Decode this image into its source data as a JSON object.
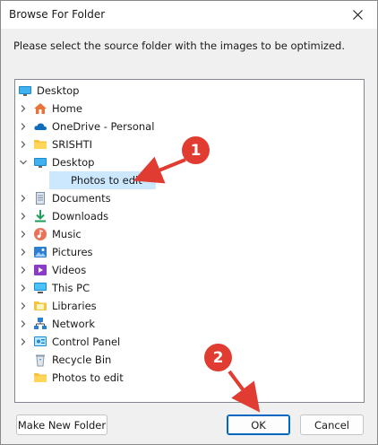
{
  "window": {
    "title": "Browse For Folder"
  },
  "instruction": "Please select the source folder with the images to be optimized.",
  "tree": [
    {
      "label": "Desktop",
      "icon": "desktop-icon",
      "level": 0,
      "chevron": "none"
    },
    {
      "label": "Home",
      "icon": "home-icon",
      "level": 1,
      "chevron": "right"
    },
    {
      "label": "OneDrive - Personal",
      "icon": "cloud-icon",
      "level": 1,
      "chevron": "right"
    },
    {
      "label": "SRISHTI",
      "icon": "folder-icon",
      "level": 1,
      "chevron": "right"
    },
    {
      "label": "Desktop",
      "icon": "desktop-icon",
      "level": 1,
      "chevron": "down"
    },
    {
      "label": "Photos to edit",
      "icon": "folder-icon",
      "level": 2,
      "chevron": "none",
      "selected": true
    },
    {
      "label": "Documents",
      "icon": "documents-icon",
      "level": 1,
      "chevron": "right"
    },
    {
      "label": "Downloads",
      "icon": "download-icon",
      "level": 1,
      "chevron": "right"
    },
    {
      "label": "Music",
      "icon": "music-icon",
      "level": 1,
      "chevron": "right"
    },
    {
      "label": "Pictures",
      "icon": "pictures-icon",
      "level": 1,
      "chevron": "right"
    },
    {
      "label": "Videos",
      "icon": "videos-icon",
      "level": 1,
      "chevron": "right"
    },
    {
      "label": "This PC",
      "icon": "pc-icon",
      "level": 1,
      "chevron": "right"
    },
    {
      "label": "Libraries",
      "icon": "libraries-icon",
      "level": 1,
      "chevron": "right"
    },
    {
      "label": "Network",
      "icon": "network-icon",
      "level": 1,
      "chevron": "right"
    },
    {
      "label": "Control Panel",
      "icon": "control-panel-icon",
      "level": 1,
      "chevron": "right"
    },
    {
      "label": "Recycle Bin",
      "icon": "recycle-bin-icon",
      "level": 1,
      "chevron": "none"
    },
    {
      "label": "Photos to edit",
      "icon": "folder-icon",
      "level": 1,
      "chevron": "none"
    }
  ],
  "buttons": {
    "make_new_folder": "Make New Folder",
    "ok": "OK",
    "cancel": "Cancel"
  },
  "annotations": {
    "badge1": "1",
    "badge2": "2"
  },
  "colors": {
    "annotation_red": "#e03c31",
    "selection": "#cce8ff",
    "primary_border": "#0067c0"
  }
}
